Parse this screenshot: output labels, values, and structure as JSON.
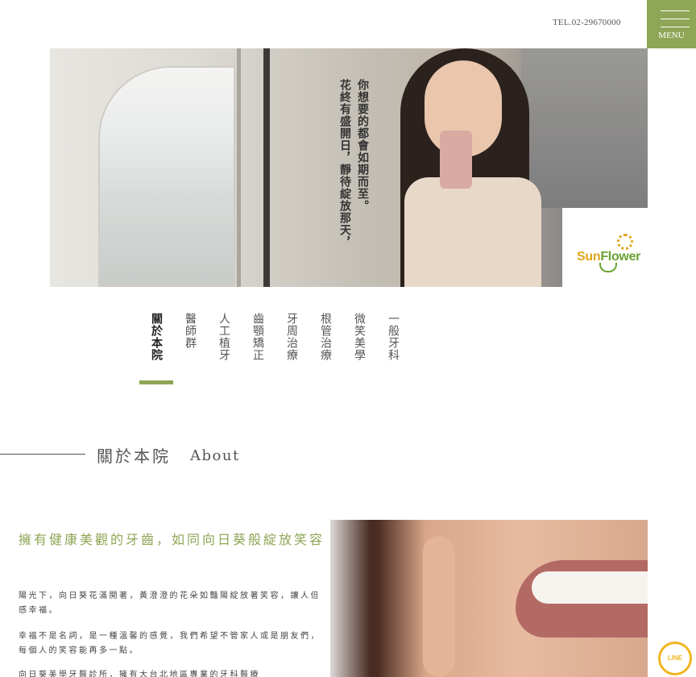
{
  "header": {
    "tel": "TEL.02-29670000",
    "menu_label": "MENU"
  },
  "hero": {
    "tagline_line1": "你想要的都會如期而至。",
    "tagline_line2": "花終有盛開日，靜待綻放那天，",
    "logo_sun": "Sun",
    "logo_flower": "Flower"
  },
  "nav": {
    "items": [
      {
        "label": "關於本院"
      },
      {
        "label": "醫師群"
      },
      {
        "label": "人工植牙"
      },
      {
        "label": "齒顎矯正"
      },
      {
        "label": "牙周治療"
      },
      {
        "label": "根管治療"
      },
      {
        "label": "微笑美學"
      },
      {
        "label": "一般牙科"
      }
    ]
  },
  "about": {
    "title_cn": "關於本院",
    "title_en": "About",
    "heading": "擁有健康美觀的牙齒，如同向日葵般綻放笑容",
    "paragraph1": "陽光下，向日葵花滿開著，黃澄澄的花朵如豔陽綻放著笑容，讓人倍感幸福。",
    "paragraph2": "幸福不是名詞，是一種溫馨的感覺，我們希望不管家人或是朋友們，每個人的笑容能再多一點。",
    "paragraph3": "向日葵美學牙醫診所，擁有大台北地區專業的牙科醫療"
  },
  "floating": {
    "line_label": "LINE"
  },
  "colors": {
    "accent_green": "#8fa656",
    "line_yellow": "#f1b51f"
  }
}
